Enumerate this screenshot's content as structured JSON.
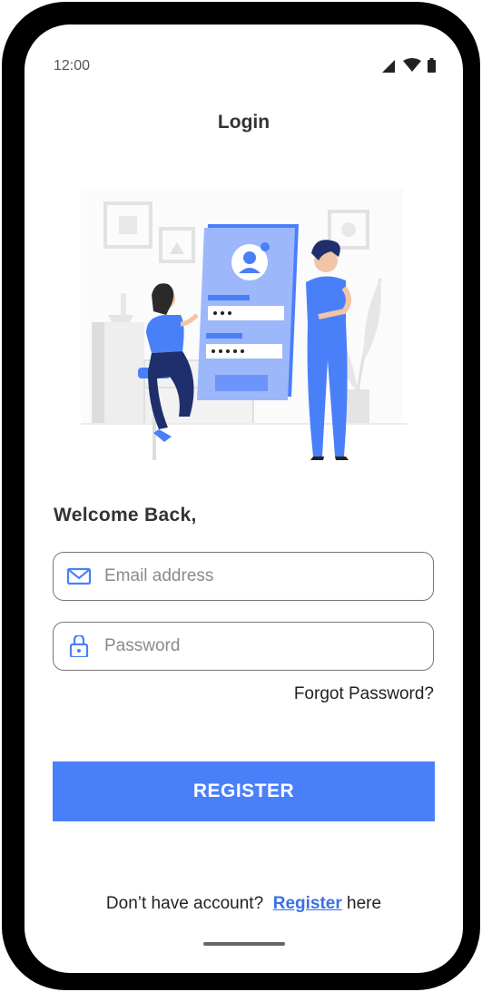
{
  "status_bar": {
    "time": "12:00",
    "icons": [
      "cell-signal-icon",
      "wifi-icon",
      "battery-icon"
    ]
  },
  "header": {
    "title": "Login"
  },
  "illustration": {
    "name": "login-illustration"
  },
  "form": {
    "welcome": "Welcome Back,",
    "email": {
      "placeholder": "Email address",
      "icon": "mail-icon",
      "value": ""
    },
    "password": {
      "placeholder": "Password",
      "icon": "lock-icon",
      "value": ""
    },
    "forgot_label": "Forgot Password?",
    "submit_label": "REGISTER"
  },
  "footer": {
    "prompt": "Don’t have account?",
    "link_label": "Register",
    "suffix": "here"
  },
  "colors": {
    "accent": "#4a7ffa",
    "link": "#3b70e8",
    "frame": "#000000"
  }
}
